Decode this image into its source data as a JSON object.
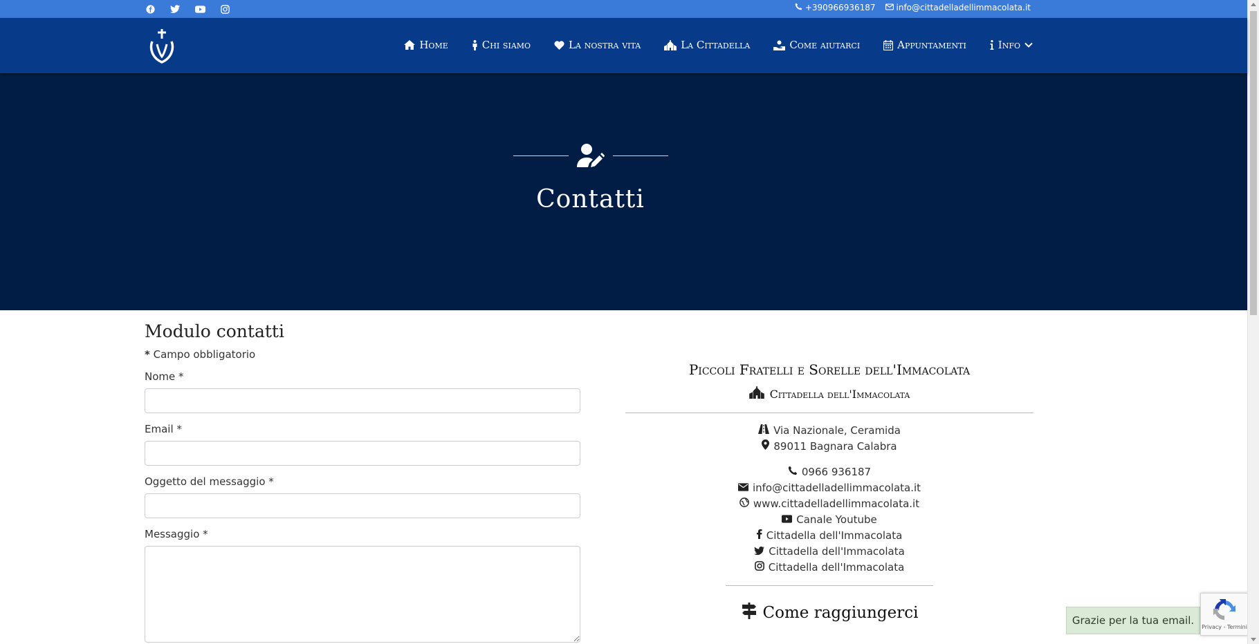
{
  "topbar": {
    "social_icons": [
      "facebook-icon",
      "twitter-icon",
      "youtube-icon",
      "instagram-icon"
    ],
    "phone": "+390966936187",
    "email": "info@cittadelladellimmacolata.it"
  },
  "nav": {
    "items": [
      {
        "label": "Home",
        "icon": "home-icon"
      },
      {
        "label": "Chi siamo",
        "icon": "person-icon"
      },
      {
        "label": "La nostra vita",
        "icon": "heart-icon"
      },
      {
        "label": "La Cittadella",
        "icon": "church-icon"
      },
      {
        "label": "Come aiutarci",
        "icon": "hand-holding-icon"
      },
      {
        "label": "Appuntamenti",
        "icon": "calendar-icon"
      },
      {
        "label": "Info",
        "icon": "info-icon"
      }
    ]
  },
  "hero": {
    "title": "Contatti",
    "icon": "user-edit-icon"
  },
  "form": {
    "title": "Modulo contatti",
    "required_mark": "*",
    "required_note": "Campo obbligatorio",
    "fields": [
      {
        "label": "Nome *",
        "value": ""
      },
      {
        "label": "Email *",
        "value": ""
      },
      {
        "label": "Oggetto del messaggio *",
        "value": ""
      },
      {
        "label": "Messaggio *",
        "value": ""
      }
    ]
  },
  "info": {
    "org_name": "Piccoli Fratelli e Sorelle dell'Immacolata",
    "sub_name": "Cittadella dell'Immacolata",
    "address_line1": "Via Nazionale, Ceramida",
    "address_line2": "89011 Bagnara Calabra",
    "phone": "0966 936187",
    "email": "info@cittadelladellimmacolata.it",
    "website": "www.cittadelladellimmacolata.it",
    "youtube": "Canale Youtube",
    "facebook": "Cittadella dell'Immacolata",
    "twitter": "Cittadella dell'Immacolata",
    "instagram": "Cittadella dell'Immacolata",
    "reach_title": "Come raggiungerci"
  },
  "toast": {
    "message": "Grazie per la tua email."
  },
  "recaptcha": {
    "links": "Privacy - Termini"
  },
  "colors": {
    "topbar": "#3a7ad8",
    "navbar": "#083a8a",
    "hero": "#011d45",
    "toast_bg": "#dbe9d7"
  }
}
